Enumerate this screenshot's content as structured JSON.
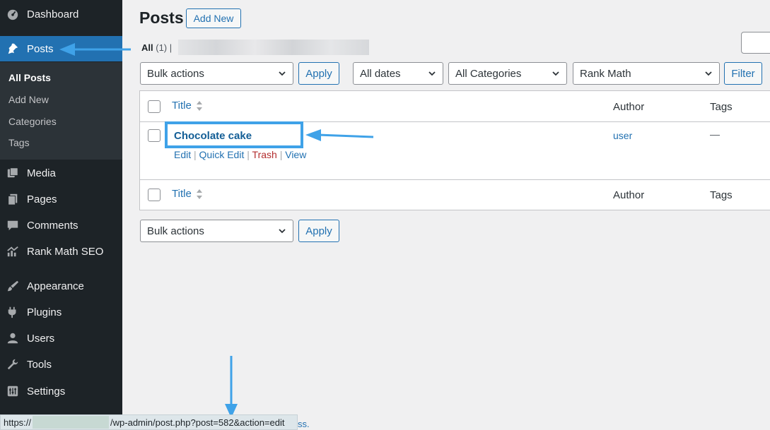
{
  "sidebar": {
    "items": [
      {
        "label": "Dashboard",
        "icon": "dashboard-icon"
      },
      {
        "label": "Posts",
        "icon": "pushpin-icon",
        "active": true
      },
      {
        "label": "Media",
        "icon": "media-icon"
      },
      {
        "label": "Pages",
        "icon": "pages-icon"
      },
      {
        "label": "Comments",
        "icon": "comments-icon"
      },
      {
        "label": "Rank Math SEO",
        "icon": "rank-math-icon"
      },
      {
        "label": "Appearance",
        "icon": "paintbrush-icon"
      },
      {
        "label": "Plugins",
        "icon": "plugin-icon"
      },
      {
        "label": "Users",
        "icon": "users-icon"
      },
      {
        "label": "Tools",
        "icon": "wrench-icon"
      },
      {
        "label": "Settings",
        "icon": "settings-icon"
      }
    ],
    "submenu": [
      {
        "label": "All Posts",
        "current": true
      },
      {
        "label": "Add New"
      },
      {
        "label": "Categories"
      },
      {
        "label": "Tags"
      }
    ]
  },
  "header": {
    "title": "Posts",
    "add_new_label": "Add New"
  },
  "filters": {
    "all_label": "All",
    "all_count": "(1)",
    "separator": "|"
  },
  "toolbar_top": {
    "bulk_actions": "Bulk actions",
    "apply_label": "Apply",
    "dates": "All dates",
    "categories": "All Categories",
    "rank_math": "Rank Math",
    "filter_label": "Filter"
  },
  "table": {
    "columns": {
      "title": "Title",
      "author": "Author",
      "tags": "Tags"
    },
    "rows": [
      {
        "title": "Chocolate cake",
        "author": "user",
        "tags": "—",
        "actions": {
          "edit": "Edit",
          "quick_edit": "Quick Edit",
          "trash": "Trash",
          "view": "View",
          "separator": "|"
        }
      }
    ]
  },
  "toolbar_bottom": {
    "bulk_actions": "Bulk actions",
    "apply_label": "Apply"
  },
  "status_bar": {
    "prefix": "https://",
    "path": "/wp-admin/post.php?post=582&action=edit"
  },
  "bottom_link_fragment": "ss.",
  "colors": {
    "sidebar_bg": "#1d2327",
    "active_bg": "#2271b1",
    "link": "#2271b1",
    "trash": "#b32d2e",
    "annotation": "#3fa2e8"
  }
}
